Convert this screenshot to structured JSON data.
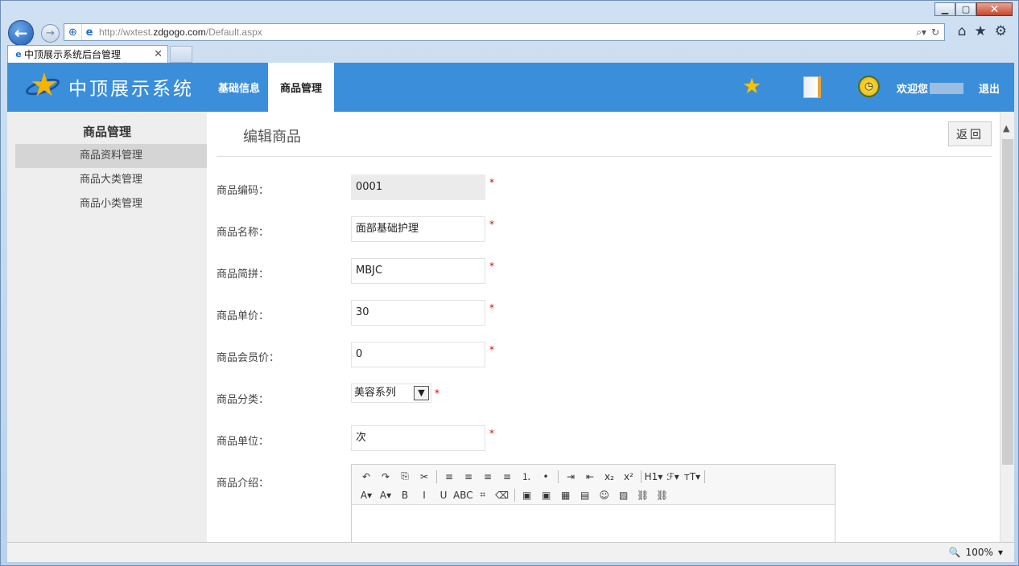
{
  "browser": {
    "url_prefix": "http://wxtest.",
    "url_domain": "zdgogo.com",
    "url_path": "/Default.aspx",
    "tab_title": "中顶展示系统后台管理",
    "zoom": "100%"
  },
  "header": {
    "logo_text": "中顶展示系统",
    "nav": [
      "基础信息",
      "商品管理"
    ],
    "welcome": "欢迎您",
    "logout": "退出"
  },
  "sidebar": {
    "title": "商品管理",
    "items": [
      "商品资料管理",
      "商品大类管理",
      "商品小类管理"
    ]
  },
  "page": {
    "title": "编辑商品",
    "back_button": "返回"
  },
  "form": {
    "code_label": "商品编码：",
    "code_value": "0001",
    "name_label": "商品名称：",
    "name_value": "面部基础护理",
    "pinyin_label": "商品简拼：",
    "pinyin_value": "MBJC",
    "price_label": "商品单价：",
    "price_value": "30",
    "member_price_label": "商品会员价：",
    "member_price_value": "0",
    "category_label": "商品分类：",
    "category_value": "美容系列",
    "unit_label": "商品单位：",
    "unit_value": "次",
    "intro_label": "商品介绍：",
    "required_mark": "*"
  },
  "editor": {
    "row1": [
      "↶",
      "↷",
      "⎘",
      "✂",
      "|",
      "≡",
      "≡",
      "≡",
      "≡",
      "⒈",
      "•",
      "|",
      "⇥",
      "⇤",
      "x₂",
      "x²",
      "|",
      "H1▾",
      "ℱ▾",
      "ᴛT▾",
      "|"
    ],
    "row2": [
      "A▾",
      "A▾",
      "B",
      "I",
      "U",
      "ABC",
      "⌗",
      "⌫",
      "|",
      "▣",
      "▣",
      "▦",
      "▤",
      "☺",
      "▨",
      "⛓",
      "⛓"
    ]
  }
}
